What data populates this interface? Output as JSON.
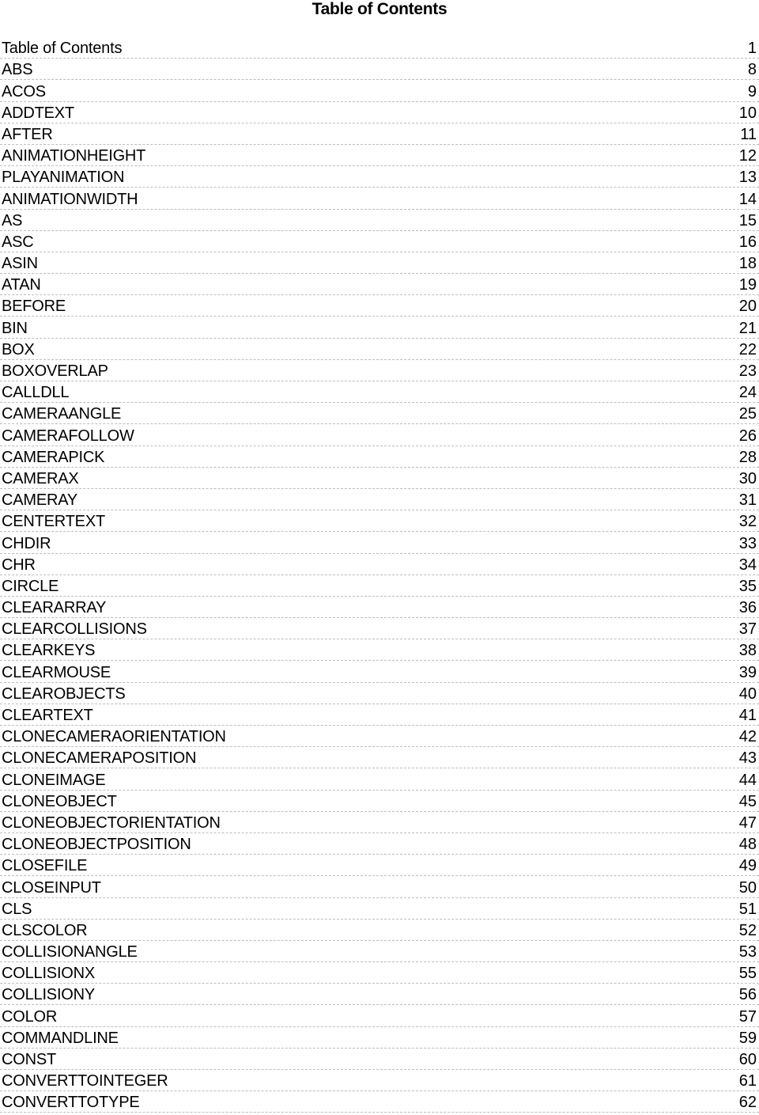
{
  "header": {
    "title": "Table of Contents"
  },
  "toc": {
    "entries": [
      {
        "label": "Table of Contents",
        "page": "1"
      },
      {
        "label": "ABS",
        "page": "8"
      },
      {
        "label": "ACOS",
        "page": "9"
      },
      {
        "label": "ADDTEXT",
        "page": "10"
      },
      {
        "label": "AFTER",
        "page": "11"
      },
      {
        "label": "ANIMATIONHEIGHT",
        "page": "12"
      },
      {
        "label": "PLAYANIMATION",
        "page": "13"
      },
      {
        "label": "ANIMATIONWIDTH",
        "page": "14"
      },
      {
        "label": "AS",
        "page": "15"
      },
      {
        "label": "ASC",
        "page": "16"
      },
      {
        "label": "ASIN",
        "page": "18"
      },
      {
        "label": "ATAN",
        "page": "19"
      },
      {
        "label": "BEFORE",
        "page": "20"
      },
      {
        "label": "BIN",
        "page": "21"
      },
      {
        "label": "BOX",
        "page": "22"
      },
      {
        "label": "BOXOVERLAP",
        "page": "23"
      },
      {
        "label": "CALLDLL",
        "page": "24"
      },
      {
        "label": "CAMERAANGLE",
        "page": "25"
      },
      {
        "label": "CAMERAFOLLOW",
        "page": "26"
      },
      {
        "label": "CAMERAPICK",
        "page": "28"
      },
      {
        "label": "CAMERAX",
        "page": "30"
      },
      {
        "label": "CAMERAY",
        "page": "31"
      },
      {
        "label": "CENTERTEXT",
        "page": "32"
      },
      {
        "label": "CHDIR",
        "page": "33"
      },
      {
        "label": "CHR",
        "page": "34"
      },
      {
        "label": "CIRCLE",
        "page": "35"
      },
      {
        "label": "CLEARARRAY",
        "page": "36"
      },
      {
        "label": "CLEARCOLLISIONS",
        "page": "37"
      },
      {
        "label": "CLEARKEYS",
        "page": "38"
      },
      {
        "label": "CLEARMOUSE",
        "page": "39"
      },
      {
        "label": "CLEAROBJECTS",
        "page": "40"
      },
      {
        "label": "CLEARTEXT",
        "page": "41"
      },
      {
        "label": "CLONECAMERAORIENTATION",
        "page": "42"
      },
      {
        "label": "CLONECAMERAPOSITION",
        "page": "43"
      },
      {
        "label": "CLONEIMAGE",
        "page": "44"
      },
      {
        "label": "CLONEOBJECT",
        "page": "45"
      },
      {
        "label": "CLONEOBJECTORIENTATION",
        "page": "47"
      },
      {
        "label": "CLONEOBJECTPOSITION",
        "page": "48"
      },
      {
        "label": "CLOSEFILE",
        "page": "49"
      },
      {
        "label": "CLOSEINPUT",
        "page": "50"
      },
      {
        "label": "CLS",
        "page": "51"
      },
      {
        "label": "CLSCOLOR",
        "page": "52"
      },
      {
        "label": "COLLISIONANGLE",
        "page": "53"
      },
      {
        "label": "COLLISIONX",
        "page": "55"
      },
      {
        "label": "COLLISIONY",
        "page": "56"
      },
      {
        "label": "COLOR",
        "page": "57"
      },
      {
        "label": "COMMANDLINE",
        "page": "59"
      },
      {
        "label": "CONST",
        "page": "60"
      },
      {
        "label": "CONVERTTOINTEGER",
        "page": "61"
      },
      {
        "label": "CONVERTTOTYPE",
        "page": "62"
      }
    ]
  }
}
